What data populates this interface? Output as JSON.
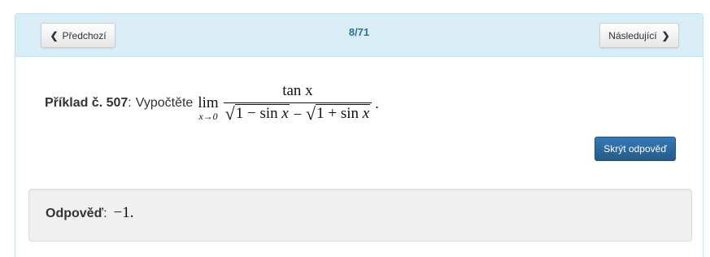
{
  "nav": {
    "prev_label": "Předchozí",
    "next_label": "Následující",
    "page_counter": "8/71"
  },
  "problem": {
    "title": "Příklad č. 507",
    "separator": ":",
    "instruction": "Vypočtěte",
    "lim_word": "lim",
    "lim_sub": "x→0",
    "numerator": "tan x",
    "den_term1_func": "1 − sin ",
    "den_term1_var": "x",
    "den_minus": " − ",
    "den_term2_func": "1 + sin ",
    "den_term2_var": "x",
    "end": "."
  },
  "actions": {
    "hide_answer_label": "Skrýt odpověď"
  },
  "answer": {
    "label": "Odpověď",
    "separator": ":",
    "value": "−1."
  },
  "colors": {
    "heading_bg": "#d9edf7",
    "heading_border": "#bce8f1",
    "primary_button": "#337ab7",
    "counter_text": "#31708f"
  },
  "icons": {
    "prev": "chevron-left-icon",
    "next": "chevron-right-icon"
  }
}
